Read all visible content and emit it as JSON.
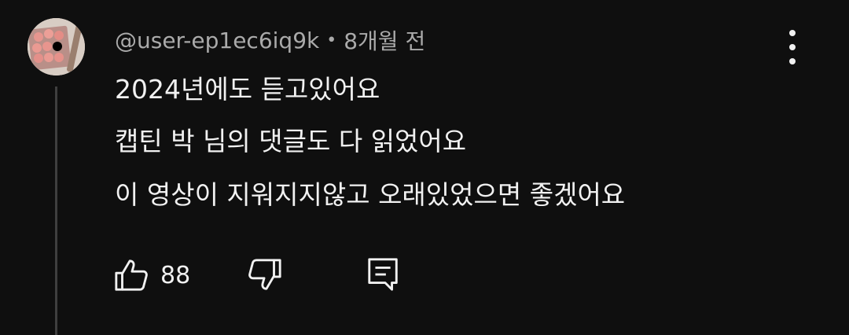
{
  "comment": {
    "author": "@user-ep1ec6iq9k",
    "separator": "•",
    "time_ago": "8개월 전",
    "lines": [
      "2024년에도 듣고있어요",
      "캡틴 박 님의 댓글도 다 읽었어요",
      "이 영상이 지워지지않고 오래있었으면 좋겠어요"
    ],
    "like_count": "88"
  },
  "icons": {
    "avatar": "avatar-image",
    "more": "more-vertical-icon",
    "like": "thumb-up-icon",
    "dislike": "thumb-down-icon",
    "reply": "reply-comment-icon"
  },
  "colors": {
    "background": "#0f0f0f",
    "text_primary": "#f1f1f1",
    "text_secondary": "#aaaaaa",
    "thread_line": "#3f3f3f"
  }
}
